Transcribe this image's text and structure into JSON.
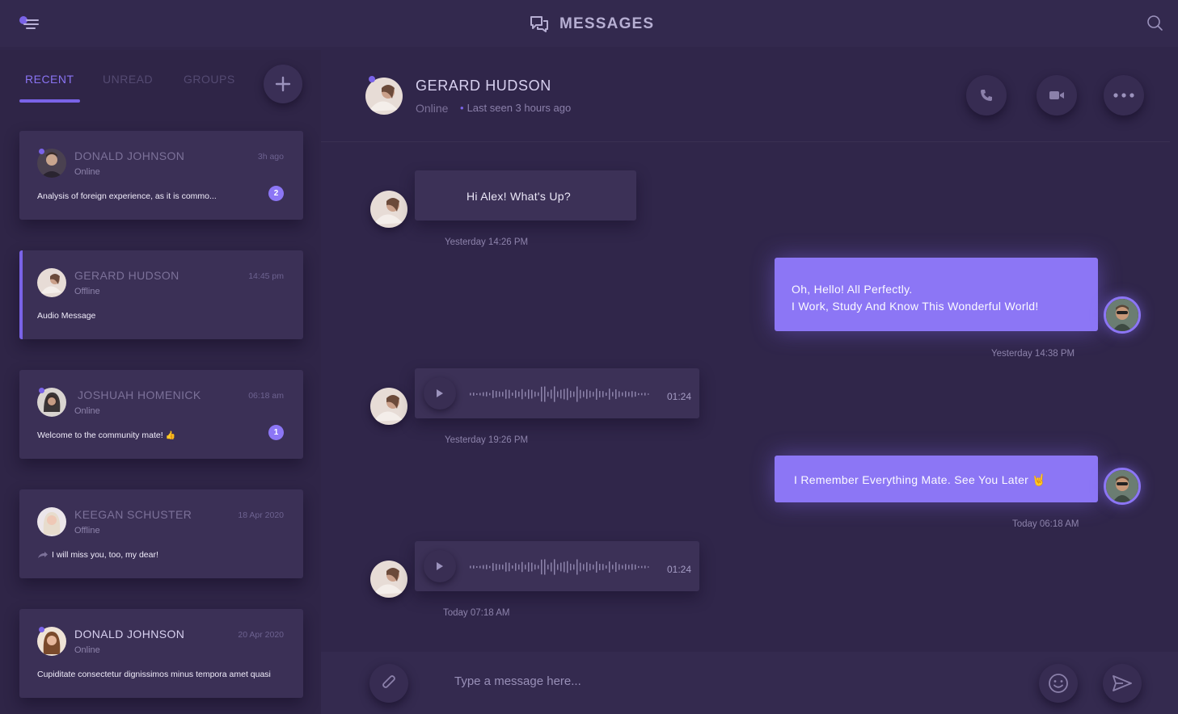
{
  "header": {
    "title": "MESSAGES"
  },
  "colors": {
    "accent": "#8c76f5",
    "background": "#30264a",
    "card": "#3b3056"
  },
  "sidebar": {
    "tabs": [
      {
        "label": "RECENT"
      },
      {
        "label": "UNREAD"
      },
      {
        "label": "GROUPS"
      }
    ],
    "active_tab": "RECENT",
    "conversations": [
      {
        "name": "DONALD JOHNSON",
        "status": "Online",
        "time": "3h ago",
        "preview": "Analysis of foreign experience, as it is commo...",
        "unread": "2"
      },
      {
        "name": "GERARD HUDSON",
        "status": "Offline",
        "time": "14:45 pm",
        "preview": "Audio Message"
      },
      {
        "name": "JOSHUAH HOMENICK",
        "status": "Online",
        "time": "06:18 am",
        "preview": "Welcome to the community mate!",
        "unread": "1"
      },
      {
        "name": "KEEGAN SCHUSTER",
        "status": "Offline",
        "time": "18 Apr 2020",
        "preview": "I will miss you, too, my dear!"
      },
      {
        "name": "DONALD JOHNSON",
        "status": "Online",
        "time": "20 Apr 2020",
        "preview": "Cupiditate consectetur dignissimos minus tempora amet quasi"
      }
    ]
  },
  "chat": {
    "contact": {
      "name": "GERARD HUDSON",
      "status": "Online",
      "last_seen": "Last seen 3 hours ago"
    },
    "messages": [
      {
        "direction": "in",
        "text": "Hi Alex! What's Up?",
        "time": "Yesterday 14:26 PM"
      },
      {
        "direction": "out",
        "lines": [
          "Oh, Hello! All Perfectly.",
          "I Work, Study And Know This Wonderful World!"
        ],
        "time": "Yesterday 14:38 PM"
      },
      {
        "direction": "in",
        "audio_duration": "01:24",
        "time": "Yesterday 19:26 PM"
      },
      {
        "direction": "out",
        "text": "I Remember Everything Mate. See You Later",
        "time": "Today 06:18 AM"
      },
      {
        "direction": "in",
        "audio_duration": "01:24",
        "time": "Today 07:18 AM"
      }
    ],
    "composer": {
      "placeholder": "Type a message here..."
    }
  }
}
